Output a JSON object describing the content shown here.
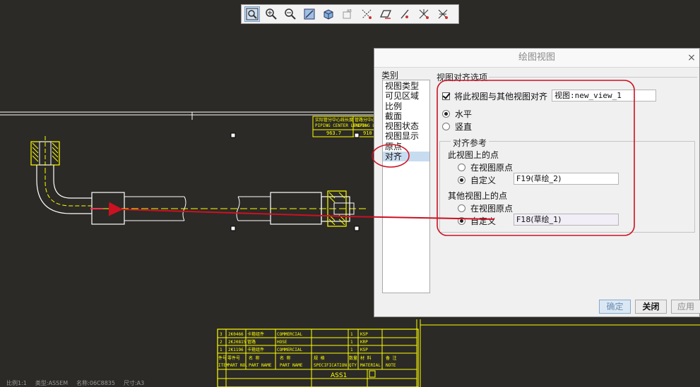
{
  "toolbar": {
    "buttons": [
      {
        "icon": "zoom-fit-icon"
      },
      {
        "icon": "zoom-in-icon"
      },
      {
        "icon": "zoom-out-icon"
      },
      {
        "icon": "repaint-icon"
      },
      {
        "icon": "shaded-view-icon"
      },
      {
        "icon": "saved-views-icon"
      },
      {
        "icon": "datum-axes-icon"
      },
      {
        "icon": "datum-planes-icon"
      },
      {
        "icon": "datum-points-icon"
      },
      {
        "icon": "coordinate-systems-icon"
      },
      {
        "icon": "annotations-icon"
      }
    ]
  },
  "drawing": {
    "dim_label_1": "实际管分中心线长度",
    "dim_label_1_en": "PIPING CENTER LENGTH",
    "dim_value_1": "963.7",
    "dim_label_2": "管路分中心线长",
    "dim_label_2_en": "PIPING L",
    "dim_value_2": "910",
    "titleblock": {
      "rows": [
        {
          "no": "3",
          "code": "2K0466",
          "name": "卡箍组件",
          "material": "COMMERCIAL",
          "qty": "1",
          "note": "KSP"
        },
        {
          "no": "2",
          "code": "2KJ0815",
          "name": "管路",
          "material": "HOSE",
          "qty": "1",
          "note": "KRP"
        },
        {
          "no": "1",
          "code": "2K1196",
          "name": "卡箍组件",
          "material": "COMMERCIAL",
          "qty": "1",
          "note": "KSP"
        }
      ],
      "headers": [
        {
          "cn": "件号",
          "en": "ITEM"
        },
        {
          "cn": "零件号",
          "en": "PART NO."
        },
        {
          "cn": "名 称",
          "en": "PART NAME"
        },
        {
          "cn": "名 称",
          "en": "PART NAME"
        },
        {
          "cn": "规 格",
          "en": "SPECIFICATION"
        },
        {
          "cn": "数量",
          "en": "QTY"
        },
        {
          "cn": "材 料",
          "en": "MATERIAL"
        },
        {
          "cn": "备 注",
          "en": "NOTE"
        }
      ],
      "assembly_name": "ASS1"
    }
  },
  "status_bar": {
    "scale": "比例1:1",
    "type": "类型:ASSEM",
    "name": "名称:06C8835",
    "size": "尺寸:A3"
  },
  "dialog": {
    "title": "绘图视图",
    "close": "×",
    "category_label": "类别",
    "categories": [
      "视图类型",
      "可见区域",
      "比例",
      "截面",
      "视图状态",
      "视图显示",
      "原点",
      "对齐"
    ],
    "selected_category": "对齐",
    "options_title": "视图对齐选项",
    "align_checkbox_label": "将此视图与其他视图对齐",
    "align_checked": true,
    "view_field": "视图:new_view_1",
    "orientation": [
      {
        "label": "水平",
        "selected": true
      },
      {
        "label": "竖直",
        "selected": false
      }
    ],
    "reference_group_title": "对齐参考",
    "this_view_title": "此视图上的点",
    "this_view_options": [
      {
        "label": "在视图原点",
        "selected": false
      },
      {
        "label": "自定义",
        "selected": true
      }
    ],
    "this_view_field": "F19(草绘_2)",
    "other_view_title": "其他视图上的点",
    "other_view_options": [
      {
        "label": "在视图原点",
        "selected": false
      },
      {
        "label": "自定义",
        "selected": true
      }
    ],
    "other_view_field": "F18(草绘_1)",
    "buttons": {
      "ok": "确定",
      "close": "关闭",
      "apply": "应用"
    }
  },
  "colors": {
    "canvas": "#2b2a26",
    "drawing_yellow": "#ffff00",
    "annotation_red": "#cc1122"
  }
}
